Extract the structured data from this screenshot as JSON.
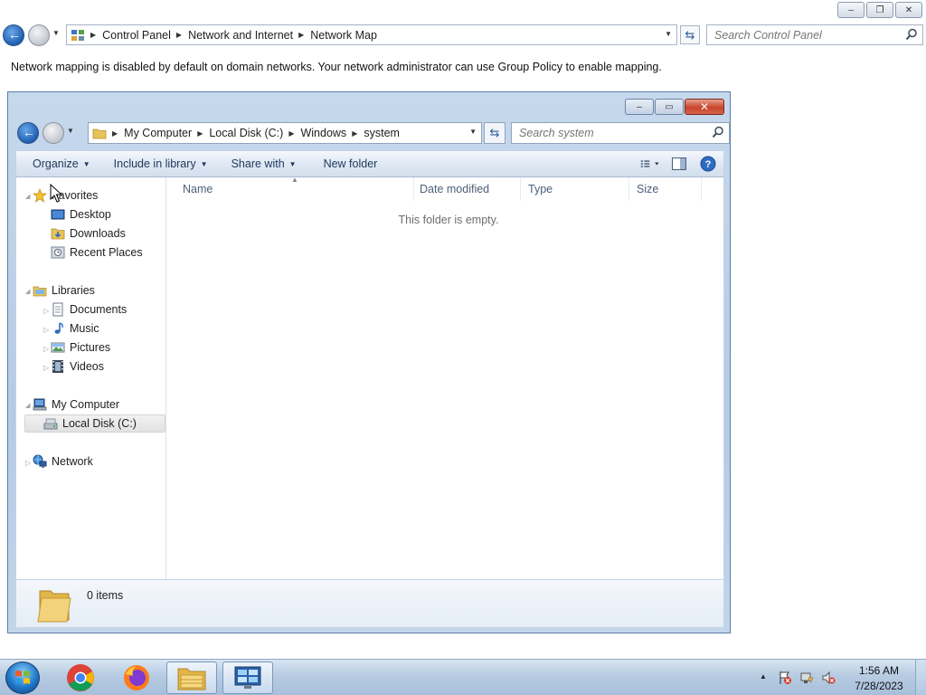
{
  "outer_window": {
    "caption_buttons": {
      "minimize": "–",
      "restore": "❐",
      "close": "✕"
    },
    "breadcrumb": [
      "Control Panel",
      "Network and Internet",
      "Network Map"
    ],
    "search_placeholder": "Search Control Panel",
    "message": "Network mapping is disabled by default on domain networks. Your network administrator can use Group Policy to enable mapping."
  },
  "explorer": {
    "breadcrumb": [
      "My Computer",
      "Local Disk (C:)",
      "Windows",
      "system"
    ],
    "search_placeholder": "Search system",
    "toolbar": {
      "organize": "Organize",
      "include_in_library": "Include in library",
      "share_with": "Share with",
      "new_folder": "New folder"
    },
    "nav_pane": {
      "favorites": {
        "label": "Favorites",
        "items": [
          "Desktop",
          "Downloads",
          "Recent Places"
        ]
      },
      "libraries": {
        "label": "Libraries",
        "items": [
          "Documents",
          "Music",
          "Pictures",
          "Videos"
        ]
      },
      "computer": {
        "label": "My Computer",
        "items": [
          "Local Disk (C:)"
        ],
        "selected": "Local Disk (C:)"
      },
      "network": {
        "label": "Network"
      }
    },
    "columns": [
      "Name",
      "Date modified",
      "Type",
      "Size"
    ],
    "empty_message": "This folder is empty.",
    "details": {
      "item_count": "0 items"
    }
  },
  "taskbar": {
    "apps": [
      "chrome-icon",
      "firefox-icon",
      "explorer-icon",
      "control-panel-icon"
    ],
    "clock": {
      "time": "1:56 AM",
      "date": "7/28/2023"
    }
  },
  "colors": {
    "accent": "#1e5fb3",
    "toolbar_text": "#1e395b",
    "taskbar": "#b9cde3",
    "close_button": "#c8452c"
  }
}
